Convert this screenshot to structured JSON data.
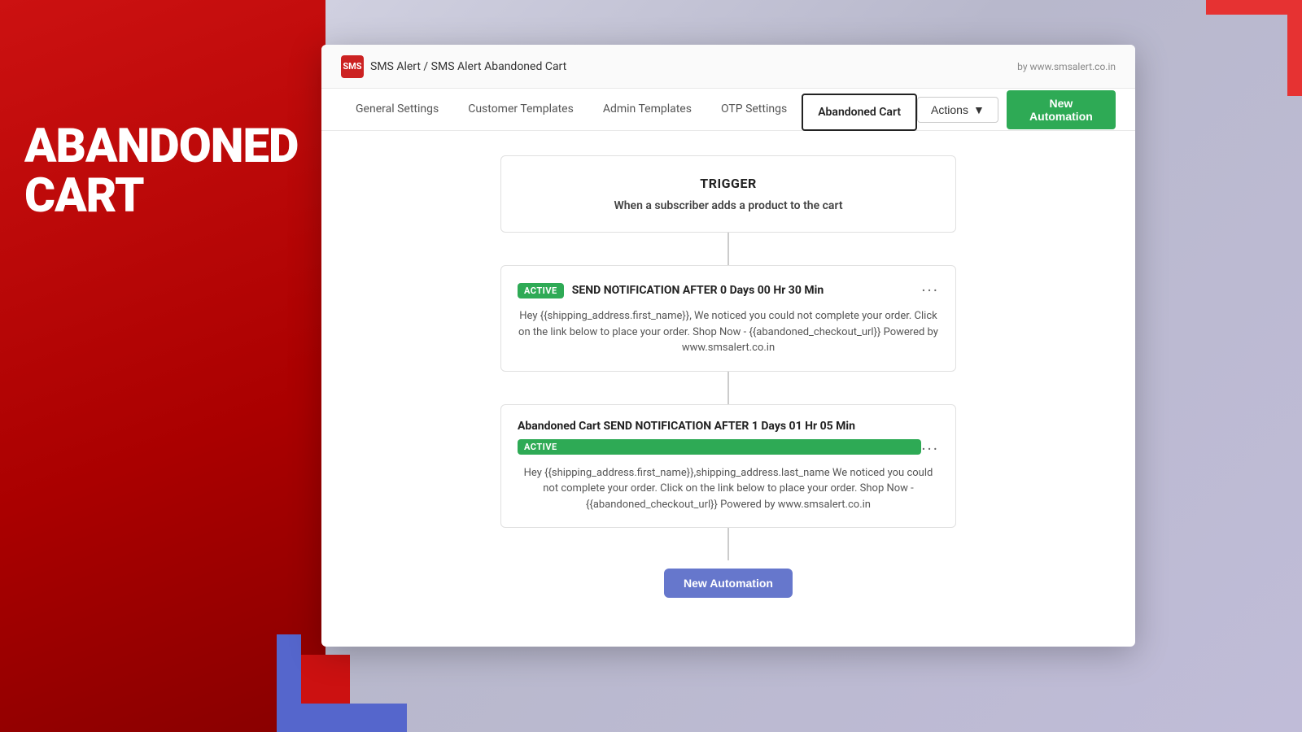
{
  "background": {
    "abandoned_line1": "ABANDONED",
    "abandoned_line2": "CART"
  },
  "topbar": {
    "breadcrumb": "SMS Alert / SMS Alert Abandoned Cart",
    "by_text": "by www.smsalert.co.in",
    "logo_label": "SMS"
  },
  "nav": {
    "tabs": [
      {
        "id": "general",
        "label": "General Settings",
        "active": false
      },
      {
        "id": "customer",
        "label": "Customer Templates",
        "active": false
      },
      {
        "id": "admin",
        "label": "Admin Templates",
        "active": false
      },
      {
        "id": "otp",
        "label": "OTP Settings",
        "active": false
      },
      {
        "id": "abandoned",
        "label": "Abandoned Cart",
        "active": true
      }
    ],
    "actions_label": "Actions",
    "new_automation_label": "New Automation"
  },
  "trigger": {
    "title": "TRIGGER",
    "subtitle": "When a subscriber adds a product to the cart"
  },
  "automation1": {
    "badge": "ACTIVE",
    "title": "SEND NOTIFICATION AFTER 0 Days 00 Hr 30 Min",
    "body": "Hey {{shipping_address.first_name}}, We noticed you could not complete your order. Click on the link below to place your order. Shop Now - {{abandoned_checkout_url}} Powered by www.smsalert.co.in"
  },
  "automation2": {
    "top_title": "Abandoned Cart SEND NOTIFICATION AFTER 1 Days 01 Hr 05 Min",
    "badge": "ACTIVE",
    "body": "Hey {{shipping_address.first_name}},shipping_address.last_name We noticed you could not complete your order. Click on the link below to place your order. Shop Now - {{abandoned_checkout_url}} Powered by www.smsalert.co.in"
  },
  "footer_button": {
    "label": "New Automation"
  }
}
